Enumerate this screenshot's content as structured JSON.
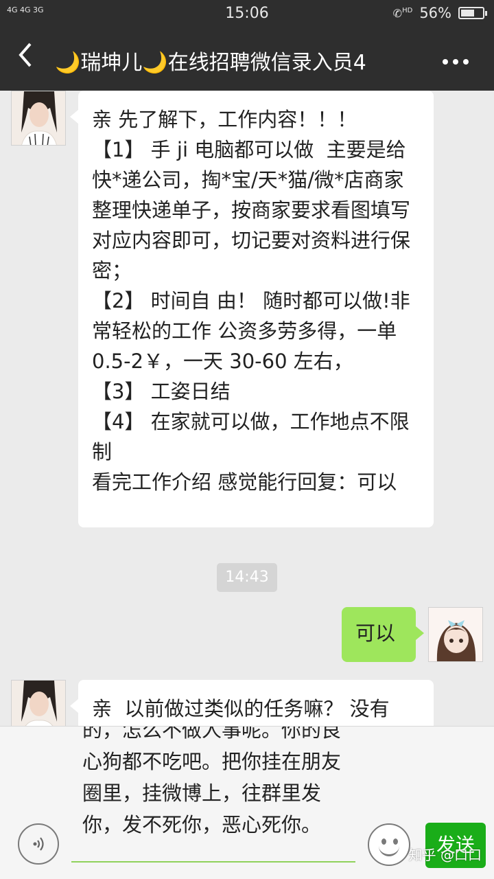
{
  "status_bar": {
    "signal": "4G 4G 3G",
    "time": "15:06",
    "hd": "HD",
    "battery": "56%",
    "battery_level": 0.56
  },
  "nav": {
    "back_icon": "chevron-left",
    "title": "🌙瑞坤儿🌙在线招聘微信录入员4",
    "more_icon": "ellipsis"
  },
  "messages": [
    {
      "side": "left",
      "text": "亲 先了解下，工作内容！！！\n【1】 手 ji 电脑都可以做  主要是给快*递公司，掏*宝/天*猫/微*店商家整理快递单子，按商家要求看图填写对应内容即可，切记要对资料进行保密；\n【2】 时间自 由！ 随时都可以做!非常轻松的工作 公资多劳多得，一单 0.5-2￥，一天 30-60 左右，\n【3】 工姿日结\n【4】 在家就可以做，工作地点不限制\n看完工作介绍 感觉能行回复：可以"
    },
    {
      "side": "time",
      "text": "14:43"
    },
    {
      "side": "right",
      "text": "可以"
    },
    {
      "side": "left",
      "text": "亲  以前做过类似的任务嘛？ 没有"
    }
  ],
  "input": {
    "text": "的，怎么不做人事呢。你的良心狗都不吃吧。把你挂在朋友圈里，挂微博上，往群里发你，发不死你，恶心死你。",
    "send_label": "发送"
  },
  "watermark": "知乎 @口口",
  "colors": {
    "bar": "#2e2e2e",
    "self_bubble": "#9ee65c",
    "send": "#1aad19"
  }
}
